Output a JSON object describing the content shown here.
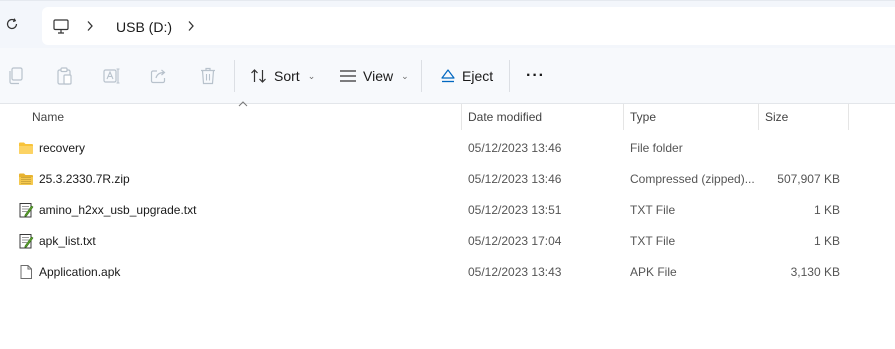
{
  "address_bar": {
    "refresh_icon": "refresh-icon",
    "pc_icon": "this-pc-icon",
    "path": [
      "USB (D:)"
    ]
  },
  "toolbar": {
    "icons": [
      "copy-icon",
      "paste-icon",
      "rename-icon",
      "share-icon",
      "delete-icon"
    ],
    "sort_label": "Sort",
    "view_label": "View",
    "eject_label": "Eject",
    "more_label": "···"
  },
  "columns": {
    "name": "Name",
    "date": "Date modified",
    "type": "Type",
    "size": "Size"
  },
  "files": [
    {
      "name": "recovery",
      "icon": "folder-icon",
      "date": "05/12/2023 13:46",
      "type": "File folder",
      "size": ""
    },
    {
      "name": "25.3.2330.7R.zip",
      "icon": "zip-icon",
      "date": "05/12/2023 13:46",
      "type": "Compressed (zipped)...",
      "size": "507,907 KB"
    },
    {
      "name": "amino_h2xx_usb_upgrade.txt",
      "icon": "text-file-icon",
      "date": "05/12/2023 13:51",
      "type": "TXT File",
      "size": "1 KB"
    },
    {
      "name": "apk_list.txt",
      "icon": "text-file-icon",
      "date": "05/12/2023 17:04",
      "type": "TXT File",
      "size": "1 KB"
    },
    {
      "name": "Application.apk",
      "icon": "file-icon",
      "date": "05/12/2023 13:43",
      "type": "APK File",
      "size": "3,130 KB"
    }
  ],
  "colors": {
    "accent": "#0067c0",
    "folder": "#f8c33b",
    "toolbar_bg": "#f7f9fc"
  }
}
